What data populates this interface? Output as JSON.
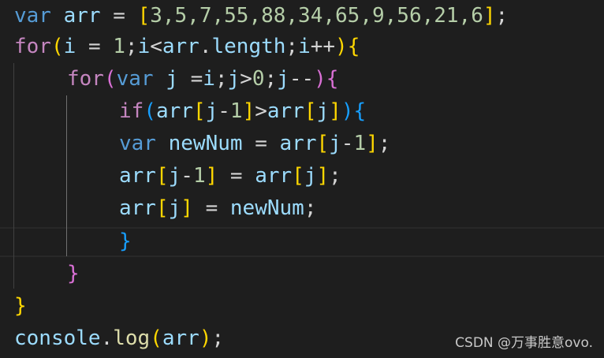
{
  "code": {
    "line1": {
      "kw": "var",
      "name": "arr",
      "eq": "=",
      "open": "[",
      "values": "3,5,7,55,88,34,65,9,56,21,6",
      "close": "]",
      "semi": ";"
    },
    "line2": {
      "kw": "for",
      "open": "(",
      "init_var": "i",
      "init_eq": "=",
      "init_val": "1",
      "semi1": ";",
      "cond_var": "i",
      "lt": "<",
      "arr": "arr",
      "dot": ".",
      "prop": "length",
      "semi2": ";",
      "inc_var": "i",
      "inc_op": "++",
      "close": ")",
      "brace": "{"
    },
    "line3": {
      "kw": "for",
      "open": "(",
      "var_kw": "var",
      "j": "j",
      "eq": "=",
      "i": "i",
      "semi1": ";",
      "j2": "j",
      "gt": ">",
      "zero": "0",
      "semi2": ";",
      "j3": "j",
      "dec": "--",
      "close": ")",
      "brace": "{"
    },
    "line4": {
      "kw": "if",
      "open": "(",
      "arr1": "arr",
      "sb1": "[",
      "j1": "j",
      "minus": "-",
      "one": "1",
      "sb1c": "]",
      "gt": ">",
      "arr2": "arr",
      "sb2": "[",
      "j2": "j",
      "sb2c": "]",
      "close": ")",
      "brace": "{"
    },
    "line5": {
      "kw": "var",
      "name": "newNum",
      "eq": "=",
      "arr": "arr",
      "sb": "[",
      "j": "j",
      "minus": "-",
      "one": "1",
      "sbc": "]",
      "semi": ";"
    },
    "line6": {
      "arr1": "arr",
      "sb1": "[",
      "j1": "j",
      "minus": "-",
      "one": "1",
      "sb1c": "]",
      "eq": "=",
      "arr2": "arr",
      "sb2": "[",
      "j2": "j",
      "sb2c": "]",
      "semi": ";"
    },
    "line7": {
      "arr": "arr",
      "sb": "[",
      "j": "j",
      "sbc": "]",
      "eq": "=",
      "name": "newNum",
      "semi": ";"
    },
    "line8": {
      "brace": "}"
    },
    "line9": {
      "brace": "}"
    },
    "line10": {
      "brace": "}"
    },
    "line11": {
      "obj": "console",
      "dot": ".",
      "fn": "log",
      "open": "(",
      "arg": "arr",
      "close": ")",
      "semi": ";"
    }
  },
  "watermark": "CSDN @万事胜意ovo.",
  "colors": {
    "background": "#1e1e1e",
    "keyword": "#569cd6",
    "control": "#c586c0",
    "variable": "#9cdcfe",
    "number": "#b5cea8",
    "function": "#dcdcaa",
    "bracket_level1": "#ffd700",
    "bracket_level2": "#da70d6",
    "bracket_level3": "#179fff"
  }
}
